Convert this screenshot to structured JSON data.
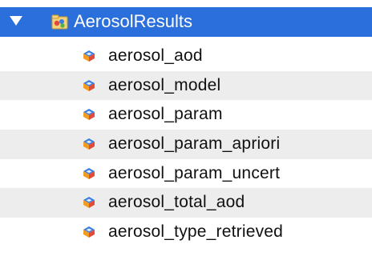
{
  "tree": {
    "group": {
      "label": "AerosolResults",
      "expanded": true,
      "icon": "group-folder-icon",
      "selected_color": "#2b6fdc"
    },
    "items": [
      {
        "label": "aerosol_aod",
        "icon": "variable-icon"
      },
      {
        "label": "aerosol_model",
        "icon": "variable-icon"
      },
      {
        "label": "aerosol_param",
        "icon": "variable-icon"
      },
      {
        "label": "aerosol_param_apriori",
        "icon": "variable-icon"
      },
      {
        "label": "aerosol_param_uncert",
        "icon": "variable-icon"
      },
      {
        "label": "aerosol_total_aod",
        "icon": "variable-icon"
      },
      {
        "label": "aerosol_type_retrieved",
        "icon": "variable-icon"
      }
    ]
  }
}
